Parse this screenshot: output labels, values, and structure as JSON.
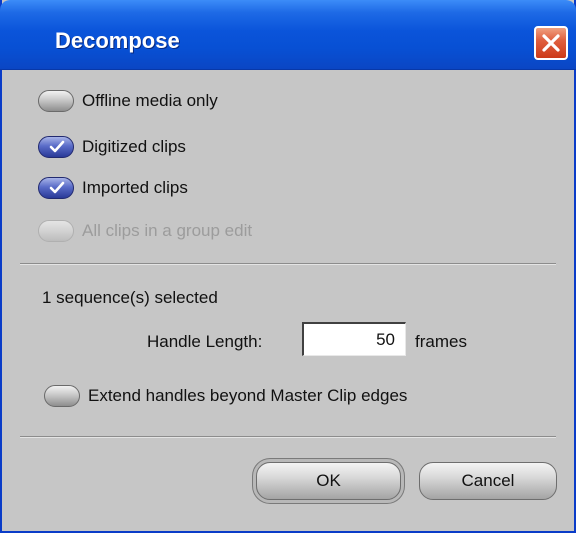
{
  "window": {
    "title": "Decompose"
  },
  "options": [
    {
      "label": "Offline media only",
      "checked": false,
      "enabled": true
    },
    {
      "label": "Digitized clips",
      "checked": true,
      "enabled": true
    },
    {
      "label": "Imported clips",
      "checked": true,
      "enabled": true
    },
    {
      "label": "All clips in a group edit",
      "checked": false,
      "enabled": false
    }
  ],
  "selection_text": "1 sequence(s) selected",
  "handle": {
    "label": "Handle Length:",
    "value": "50",
    "unit": "frames"
  },
  "extend_option": {
    "label": "Extend handles beyond Master Clip edges",
    "checked": false
  },
  "buttons": {
    "ok": "OK",
    "cancel": "Cancel"
  },
  "colors": {
    "titlebar": "#0a54da",
    "dialog_bg": "#c6c6c6",
    "checked_pill": "#3a4aa8",
    "close_button": "#d8502c"
  }
}
